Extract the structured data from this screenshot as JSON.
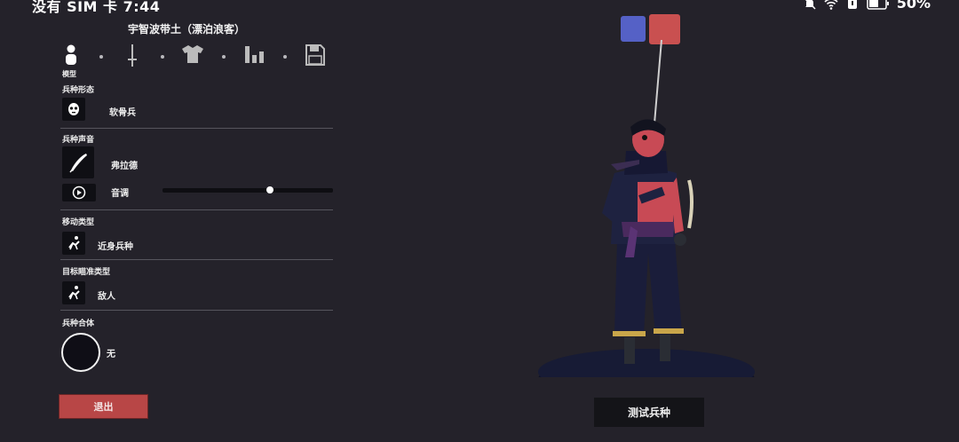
{
  "status_bar": {
    "left_text": "没有 SIM 卡 7:44",
    "battery_text": "50%"
  },
  "unit": {
    "title": "宇智波带土（漂泊浪客）"
  },
  "tabs": [
    {
      "name": "model",
      "label": "模型",
      "icon": "person-icon",
      "active": true
    },
    {
      "name": "weapon",
      "icon": "sword-icon"
    },
    {
      "name": "clothing",
      "icon": "shirt-icon"
    },
    {
      "name": "stats",
      "icon": "bar-chart-icon"
    },
    {
      "name": "save",
      "icon": "floppy-disk-icon"
    }
  ],
  "sections": {
    "unit_form": {
      "label": "兵种形态",
      "value": "软骨兵",
      "icon": "skull-mask-icon"
    },
    "unit_voice": {
      "label": "兵种声音",
      "value": "弗拉德",
      "icon": "feather-icon",
      "pitch_label": "音调",
      "pitch_level": 0.63,
      "play_icon": "play-icon"
    },
    "movement": {
      "label": "移动类型",
      "value": "近身兵种",
      "icon": "running-figure-icon"
    },
    "targeting": {
      "label": "目标瞄准类型",
      "value": "敌人",
      "icon": "target-figure-icon"
    },
    "combine": {
      "label": "兵种合体",
      "value": "无"
    }
  },
  "buttons": {
    "exit": "退出",
    "test_unit": "测试兵种"
  },
  "colors": {
    "blue_team": "#5561c6",
    "red_team": "#c95050",
    "exit_button": "#b84646"
  }
}
